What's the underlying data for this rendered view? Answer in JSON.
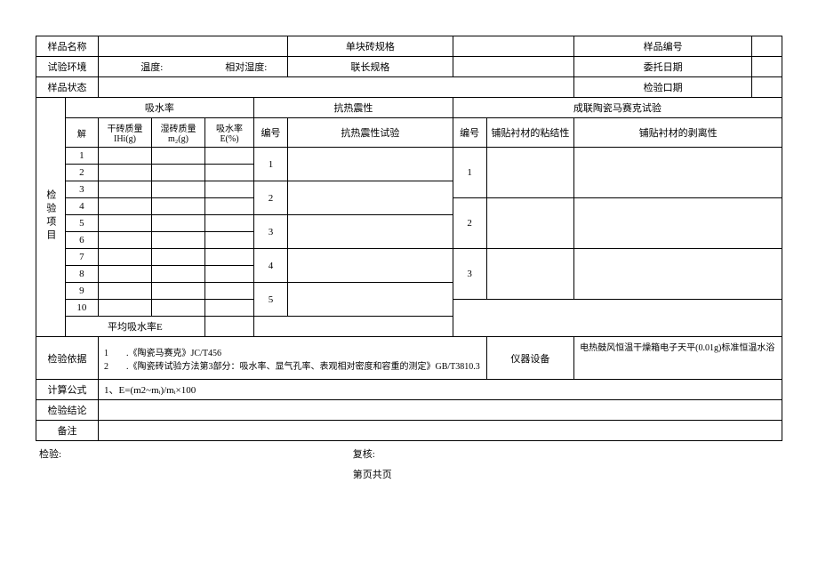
{
  "header": {
    "sample_name_label": "样品名称",
    "single_tile_spec_label": "单块砖规格",
    "sample_no_label": "样品编号",
    "test_env_label": "试验环境",
    "temperature_label": "温度:",
    "humidity_label": "相对湿度:",
    "joint_spec_label": "联长规格",
    "entrust_date_label": "委托日期",
    "sample_status_label": "样品状态",
    "inspect_date_label": "检验口期"
  },
  "sections": {
    "inspect_items_label": "检验项目",
    "water_absorption": "吸水率",
    "thermal_shock": "抗热震性",
    "mosaic_test": "成联陶瓷马赛克试验",
    "col_num": "解",
    "col_dry_mass": "干砖质量\nIHi(g)",
    "col_wet_mass": "湿砖质量\nm₂(g)",
    "col_absorption": "吸水率\nE(%)",
    "col_serial": "编号",
    "col_thermal_test": "抗热震性试验",
    "col_serial2": "编号",
    "col_adhesion": "铺贴衬材的粘结性",
    "col_peel": "铺贴衬材的剥离性",
    "avg_absorption": "平均吸水率E",
    "rows": [
      "1",
      "2",
      "3",
      "4",
      "5",
      "6",
      "7",
      "8",
      "9",
      "10"
    ],
    "thermal_rows": [
      "1",
      "2",
      "3",
      "4",
      "5"
    ],
    "mosaic_rows": [
      "1",
      "2",
      "3"
    ]
  },
  "footer": {
    "basis_label": "检验依据",
    "basis_1": "1　　.《陶瓷马赛克》JC/T456",
    "basis_2": "2　　.《陶瓷砖试验方法第3部分：吸水率、显气孔率、表观相对密度和容重的测定》GB/T3810.3",
    "equipment_label": "仪器设备",
    "equipment_text": "电热鼓风恒温干燥箱电子天平(0.01g)标准恒温水浴",
    "formula_label": "计算公式",
    "formula_text": "1、E=(m2~mᵢ)/mᵢ×100",
    "conclusion_label": "检验结论",
    "remark_label": "备注",
    "sign_inspect": "检验:",
    "sign_review": "复核:",
    "page_label": "第页共页"
  }
}
